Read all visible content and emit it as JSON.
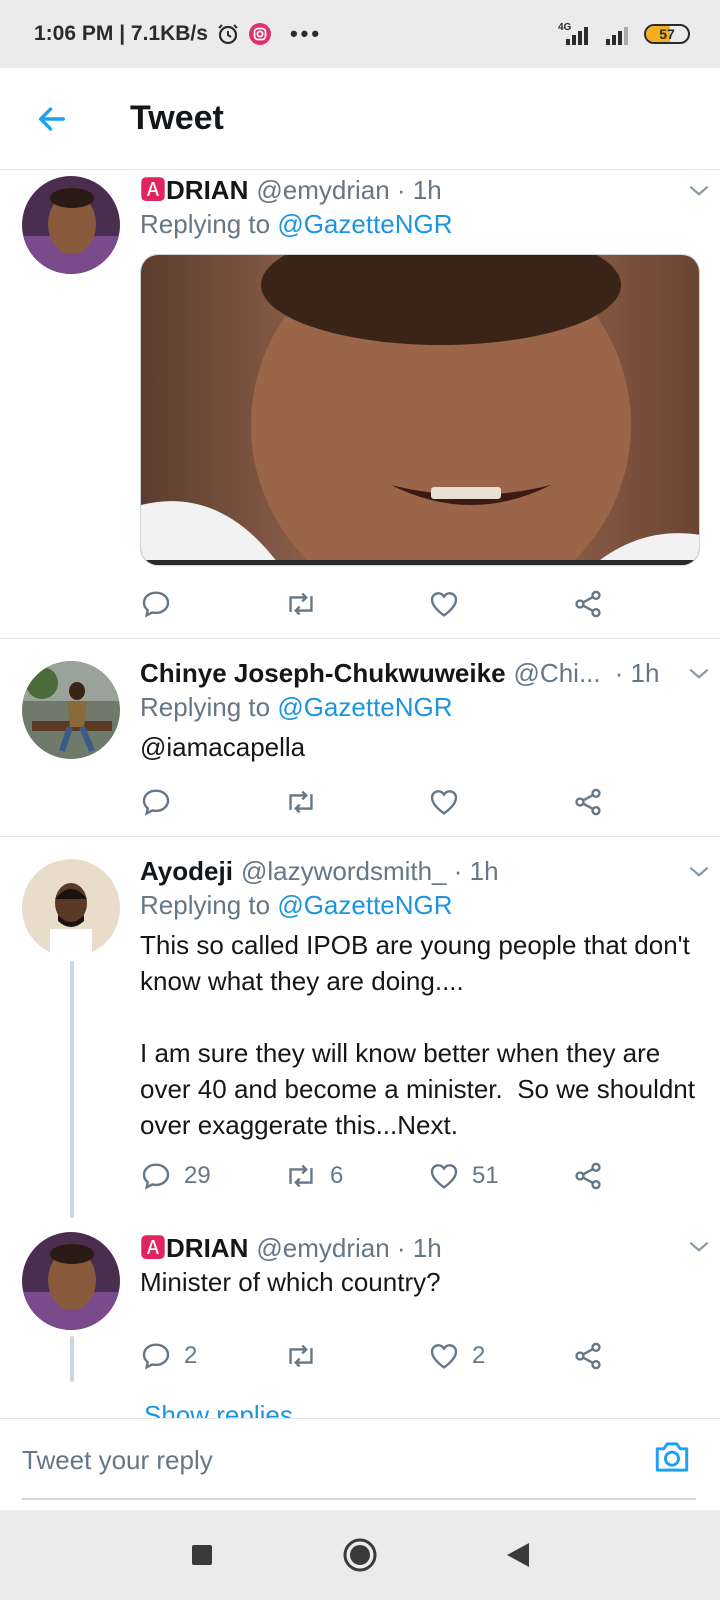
{
  "status_bar": {
    "time_speed": "1:06 PM | 7.1KB/s",
    "network": "4G",
    "battery": "57",
    "battery_level": 0.57
  },
  "header": {
    "title": "Tweet",
    "back_icon": "arrow-left-icon"
  },
  "tweets": [
    {
      "badge": "🅰",
      "name": "DRIAN",
      "handle": "@emydrian · 1h",
      "replying_label": "Replying to ",
      "replying_to": "@GazetteNGR",
      "has_media": true,
      "actions": {
        "reply": "",
        "retweet": "",
        "like": ""
      }
    },
    {
      "name": "Chinye Joseph-Chukwuweike",
      "handle": "@Chi...",
      "time": "· 1h",
      "replying_label": "Replying to ",
      "replying_to": "@GazetteNGR",
      "text": "@iamacapella",
      "actions": {
        "reply": "",
        "retweet": "",
        "like": ""
      }
    },
    {
      "name": "Ayodeji",
      "handle": "@lazywordsmith_ · 1h",
      "replying_label": "Replying to ",
      "replying_to": "@GazetteNGR",
      "text": "This so called IPOB are young people that don't know what they are doing....\n\nI am sure they will know better when they are over 40 and become a minister.  So we shouldnt over exaggerate this...Next.",
      "actions": {
        "reply": "29",
        "retweet": "6",
        "like": "51"
      }
    },
    {
      "badge": "🅰",
      "name": "DRIAN",
      "handle": "@emydrian · 1h",
      "text": "Minister of which country?",
      "actions": {
        "reply": "2",
        "retweet": "",
        "like": "2"
      }
    }
  ],
  "show_replies": "Show replies",
  "composer": {
    "placeholder": "Tweet your reply",
    "camera_icon": "camera-icon"
  },
  "colors": {
    "accent": "#1da1f2",
    "link": "#1b95e0",
    "muted": "#657786",
    "badge": "#e0245e"
  }
}
